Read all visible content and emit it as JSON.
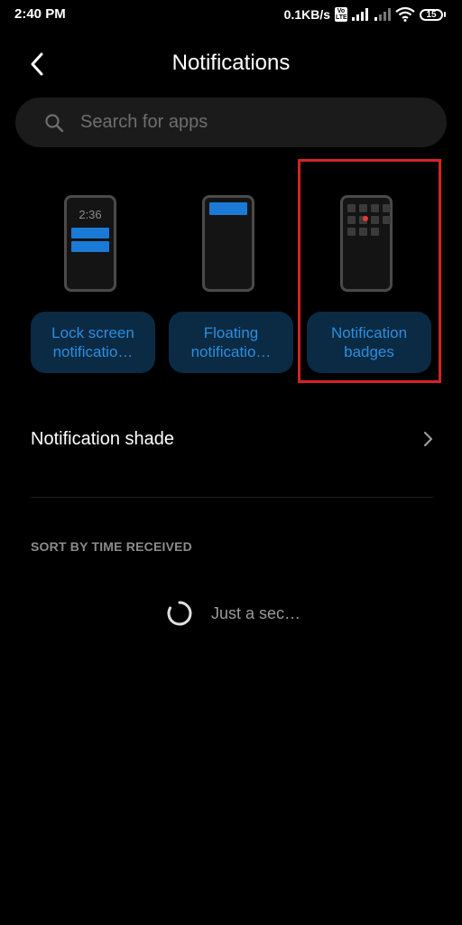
{
  "status_bar": {
    "time": "2:40 PM",
    "net_speed": "0.1KB/s",
    "volte_top": "Vo",
    "volte_bottom": "LTE",
    "battery": "15"
  },
  "header": {
    "title": "Notifications"
  },
  "search": {
    "placeholder": "Search for apps"
  },
  "cards": [
    {
      "label": "Lock screen\nnotificatio…",
      "preview_time": "2:36"
    },
    {
      "label": "Floating\nnotificatio…"
    },
    {
      "label": "Notification\nbadges"
    }
  ],
  "notification_shade": {
    "label": "Notification shade"
  },
  "section": {
    "heading": "SORT BY TIME RECEIVED"
  },
  "loading": {
    "text": "Just a sec…"
  },
  "colors": {
    "background": "#000000",
    "accent": "#2b8de0",
    "card_button": "#0b2a43",
    "highlight": "#d62128",
    "badge": "#e53935"
  }
}
